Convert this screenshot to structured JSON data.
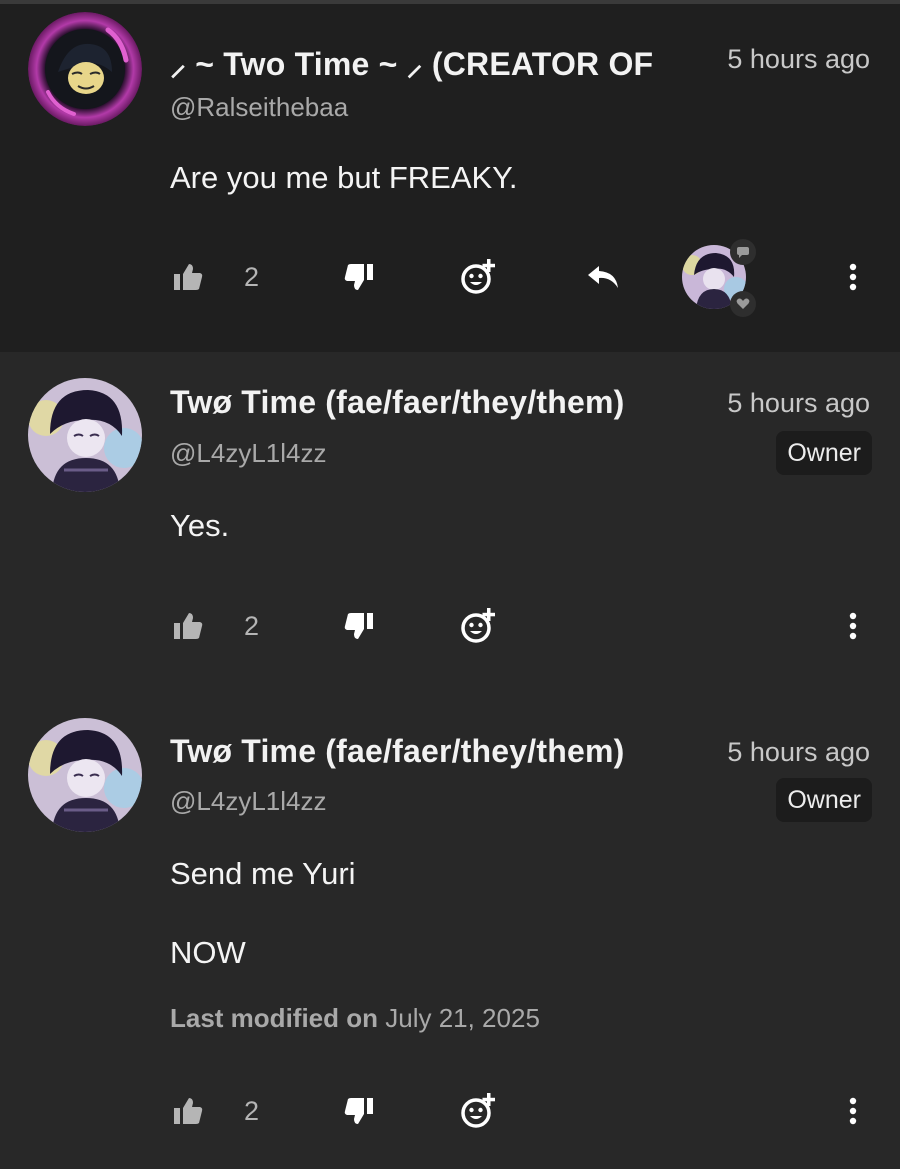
{
  "comments": [
    {
      "name": "⸝ ~ Two Time ~ ⸝ (CREATOR OF",
      "time": "5 hours ago",
      "handle": "@Ralseithebaa",
      "body": [
        "Are you me but FREAKY."
      ],
      "likes": "2",
      "has_reply": true,
      "has_creator_heart": true
    },
    {
      "name": "Twø Time (fae/faer/they/them)",
      "time": "5 hours ago",
      "handle": "@L4zyL1l4zz",
      "badge": "Owner",
      "body": [
        "Yes."
      ],
      "likes": "2"
    },
    {
      "name": "Twø Time (fae/faer/they/them)",
      "time": "5 hours ago",
      "handle": "@L4zyL1l4zz",
      "badge": "Owner",
      "body": [
        "Send me Yuri",
        "NOW"
      ],
      "modified_label": "Last modified on",
      "modified_date": "July 21, 2025",
      "likes": "2"
    }
  ],
  "icons": [
    "thumbs-up-icon",
    "thumbs-down-icon",
    "add-reaction-icon",
    "reply-icon",
    "more-options-icon"
  ],
  "colors": {
    "background": "#282828",
    "highlighted_comment": "#1f1f1f",
    "badge_bg": "#1c1c1c",
    "muted_text": "#a9a9a9"
  }
}
